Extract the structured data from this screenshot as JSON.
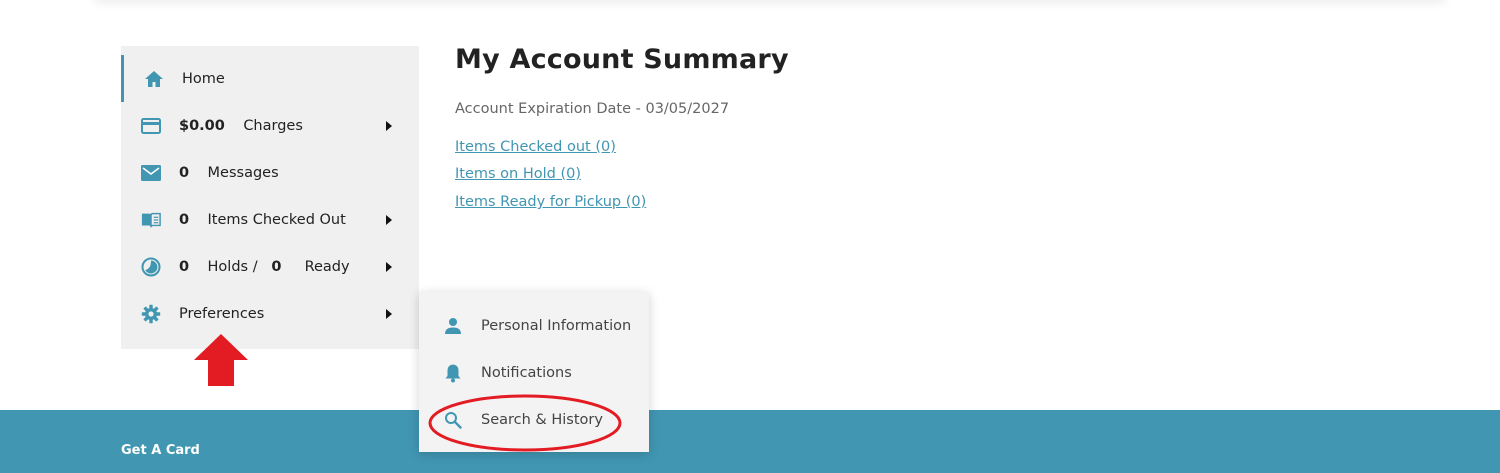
{
  "sidebar": {
    "items": [
      {
        "icon": "home-icon",
        "label": "Home"
      },
      {
        "icon": "credit-card-icon",
        "amount": "$0.00",
        "label": "Charges"
      },
      {
        "icon": "envelope-icon",
        "count": "0",
        "label": "Messages"
      },
      {
        "icon": "book-icon",
        "count": "0",
        "label": "Items Checked Out"
      },
      {
        "icon": "holds-icon",
        "holds_count": "0",
        "holds_label": "Holds /",
        "ready_count": "0",
        "ready_label": "Ready"
      },
      {
        "icon": "gear-icon",
        "label": "Preferences"
      }
    ]
  },
  "main": {
    "title": "My Account Summary",
    "expiration": "Account Expiration Date - 03/05/2027",
    "links": [
      "Items Checked out (0)",
      "Items on Hold (0)",
      "Items Ready for Pickup (0)"
    ]
  },
  "dropdown": {
    "items": [
      {
        "icon": "person-icon",
        "label": "Personal Information"
      },
      {
        "icon": "bell-icon",
        "label": "Notifications"
      },
      {
        "icon": "search-icon",
        "label": "Search & History"
      }
    ]
  },
  "footer": {
    "link": "Get A Card"
  },
  "colors": {
    "accent": "#4196b2",
    "sidebar_bg": "#f0f0f0",
    "annotation_red": "#e31b23"
  }
}
